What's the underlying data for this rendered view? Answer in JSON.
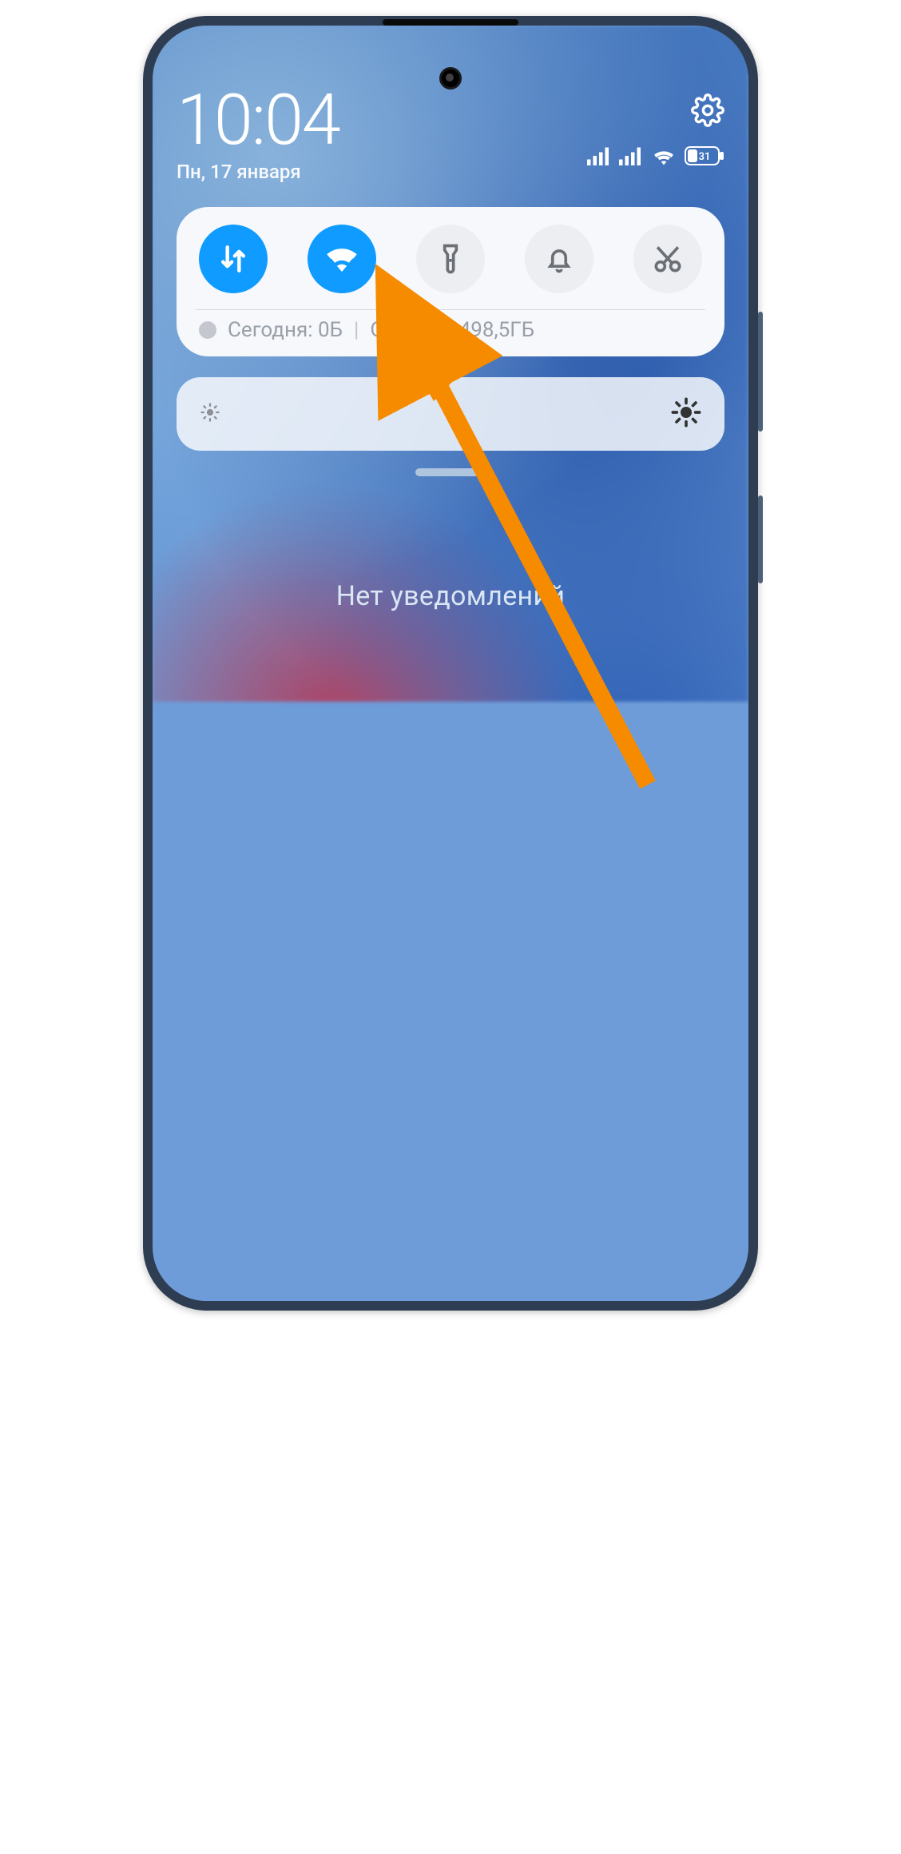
{
  "header": {
    "time": "10:04",
    "date": "Пн, 17 января"
  },
  "status": {
    "battery_percent": "31"
  },
  "quick_settings": {
    "toggles": [
      {
        "name": "mobile-data",
        "on": true
      },
      {
        "name": "wifi",
        "on": true
      },
      {
        "name": "flashlight",
        "on": false
      },
      {
        "name": "do-not-disturb",
        "on": false
      },
      {
        "name": "screenshot",
        "on": false
      }
    ],
    "data_usage": {
      "today_label": "Сегодня: 0Б",
      "separator": "|",
      "remaining_label": "Остаток: 498,5ГБ"
    }
  },
  "notifications": {
    "empty_text": "Нет уведомлений"
  }
}
